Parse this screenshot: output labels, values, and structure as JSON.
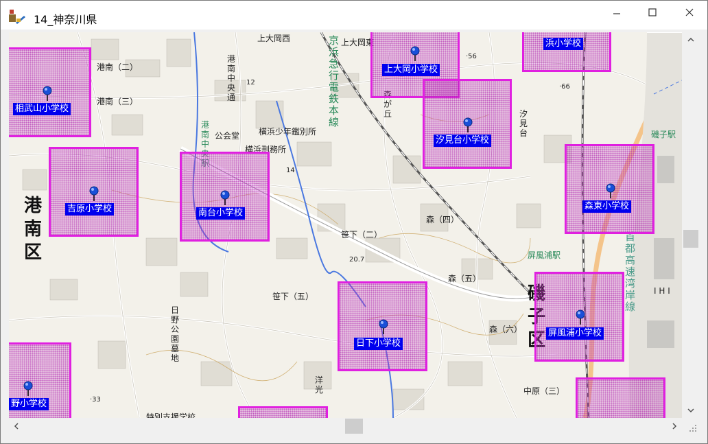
{
  "window": {
    "title": "14_神奈川県",
    "icon": "map-app-icon",
    "buttons": [
      "minimize-icon",
      "maximize-icon",
      "close-icon"
    ]
  },
  "schools": [
    {
      "name": "上大岡小学校"
    },
    {
      "name": "浜小学校"
    },
    {
      "name": "相武山小学校"
    },
    {
      "name": "汐見台小学校"
    },
    {
      "name": "吉原小学校"
    },
    {
      "name": "南台小学校"
    },
    {
      "name": "森東小学校"
    },
    {
      "name": "日下小学校"
    },
    {
      "name": "屏風浦小学校"
    },
    {
      "name": "野小学校"
    }
  ],
  "map_labels": {
    "ward_konan": "港\n南\n区",
    "ward_isogo": "磯\n子\n区",
    "keikyu_line": "京\n浜\n急\n行\n電\n鉄\n本\n線",
    "shuto_line": "首\n都\n高\n速\n湾\n岸\n線",
    "konan_chuo_station": "港\n南\n中\n央\n駅",
    "byobugaura_station": "屏風浦駅",
    "isogo_station": "磯子駅",
    "kamioooka_nishi": "上大岡西",
    "konan_ni": "港南（二）",
    "konan_san": "港南（三）",
    "konan_chuo_dori": "港\n南\n中\n央\n通",
    "kokaido": "公会堂",
    "shonen_kanbetsusho": "横浜少年鑑別所",
    "keimusho": "横浜刑務所",
    "sasage_ni": "笹下（二）",
    "sasage_go": "笹下（五）",
    "mori_yon": "森（四）",
    "mori_go": "森（五）",
    "mori_roku": "森（六）",
    "nakahara_san": "中原（三）",
    "hino_koen_bochi": "日\n野\n公\n園\n墓\n地",
    "tokubetsu_shien": "特別支援学校",
    "youko": "洋\n光",
    "morigaoka": "森\nが\n丘",
    "shiomidai": "汐\n見\n台",
    "ihi": "I H I",
    "elev_56": "·56",
    "elev_66": "·66",
    "elev_12": "12",
    "elev_14": "14",
    "elev_20": "20.7",
    "elev_33": "·33",
    "kamiooka_higashi": "上大岡東"
  },
  "colors": {
    "zone_border": "#e020e0",
    "label_bg": "#0000ee",
    "label_text": "#ffffff",
    "map_bg": "#f3f1ea"
  },
  "scrollbars": {
    "vertical": [
      "chevron-up-icon",
      "chevron-down-icon"
    ],
    "horizontal": [
      "chevron-left-icon",
      "chevron-right-icon"
    ]
  }
}
